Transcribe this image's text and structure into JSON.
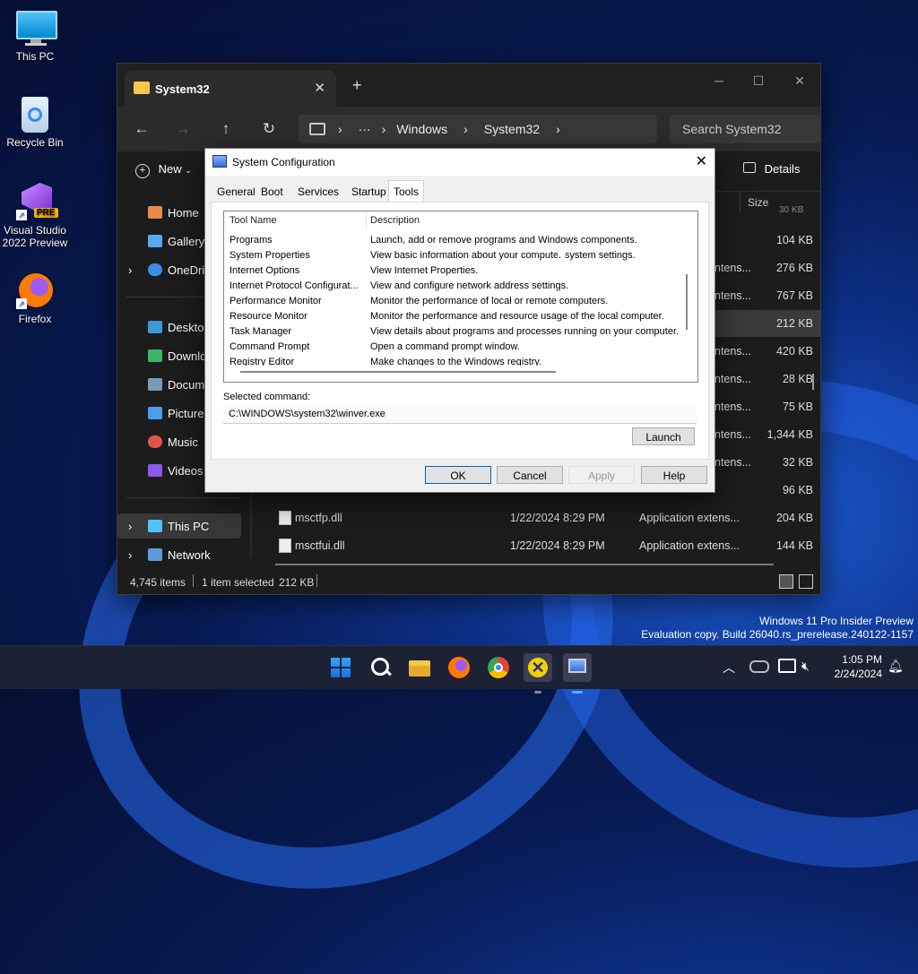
{
  "desktop": {
    "icons": [
      {
        "label": "This PC"
      },
      {
        "label": "Recycle Bin"
      },
      {
        "label": "Visual Studio 2022 Preview",
        "badge": "PRE"
      },
      {
        "label": "Firefox"
      }
    ]
  },
  "explorer": {
    "tab_title": "System32",
    "new_tab_symbol": "+",
    "breadcrumb": [
      "Windows",
      "System32"
    ],
    "breadcrumb_ellipsis": "···",
    "search_placeholder": "Search System32",
    "new_label": "New",
    "details_label": "Details",
    "size_header": "Size",
    "size_header_partial": "30 KB",
    "sidebar": [
      {
        "label": "Home"
      },
      {
        "label": "Gallery"
      },
      {
        "label": "OneDriv"
      },
      {
        "label": "Desktop"
      },
      {
        "label": "Downlo"
      },
      {
        "label": "Docume"
      },
      {
        "label": "Pictures"
      },
      {
        "label": "Music"
      },
      {
        "label": "Videos"
      },
      {
        "label": "This PC"
      },
      {
        "label": "Network"
      }
    ],
    "files": [
      {
        "name": "",
        "date": "",
        "type": "",
        "size": "104 KB"
      },
      {
        "name": "",
        "date": "",
        "type": "ntens...",
        "size": "276 KB"
      },
      {
        "name": "",
        "date": "",
        "type": "ntens...",
        "size": "767 KB"
      },
      {
        "name": "",
        "date": "",
        "type": "",
        "size": "212 KB"
      },
      {
        "name": "",
        "date": "",
        "type": "ntens...",
        "size": "420 KB"
      },
      {
        "name": "",
        "date": "",
        "type": "ntens...",
        "size": "28 KB"
      },
      {
        "name": "",
        "date": "",
        "type": "ntens...",
        "size": "75 KB"
      },
      {
        "name": "",
        "date": "",
        "type": "ntens...",
        "size": "1,344 KB"
      },
      {
        "name": "",
        "date": "",
        "type": "ntens...",
        "size": "32 KB"
      },
      {
        "name": "",
        "date": "",
        "type": "",
        "size": "96 KB"
      },
      {
        "name": "msctfp.dll",
        "date": "1/22/2024 8:29 PM",
        "type": "Application extens...",
        "size": "204 KB"
      },
      {
        "name": "msctfui.dll",
        "date": "1/22/2024 8:29 PM",
        "type": "Application extens...",
        "size": "144 KB"
      }
    ],
    "status": {
      "items": "4,745 items",
      "selected": "1 item selected",
      "selected_size": "212 KB"
    }
  },
  "dialog": {
    "title": "System Configuration",
    "tabs": [
      "General",
      "Boot",
      "Services",
      "Startup",
      "Tools"
    ],
    "active_tab": "Tools",
    "columns": [
      "Tool Name",
      "Description"
    ],
    "tools": [
      {
        "name": "Programs",
        "desc": "Launch, add or remove programs and Windows components."
      },
      {
        "name": "System Properties",
        "desc": "View basic information about your computer system settings."
      },
      {
        "name": "Internet Options",
        "desc": "View Internet Properties."
      },
      {
        "name": "Internet Protocol Configurat...",
        "desc": "View and configure network address settings."
      },
      {
        "name": "Performance Monitor",
        "desc": "Monitor the performance of local or remote computers."
      },
      {
        "name": "Resource Monitor",
        "desc": "Monitor the performance and resource usage of the local computer."
      },
      {
        "name": "Task Manager",
        "desc": "View details about programs and processes running on your computer."
      },
      {
        "name": "Command Prompt",
        "desc": "Open a command prompt window."
      },
      {
        "name": "Registry Editor",
        "desc": "Make changes to the Windows registry."
      }
    ],
    "selected_command_label": "Selected command:",
    "selected_command": "C:\\WINDOWS\\system32\\winver.exe",
    "launch_label": "Launch",
    "ok_label": "OK",
    "cancel_label": "Cancel",
    "apply_label": "Apply",
    "help_label": "Help"
  },
  "watermark": {
    "line1": "Windows 11 Pro Insider Preview",
    "line2": "Evaluation copy. Build 26040.rs_prerelease.240122-1157"
  },
  "taskbar": {
    "time": "1:05 PM",
    "date": "2/24/2024"
  }
}
